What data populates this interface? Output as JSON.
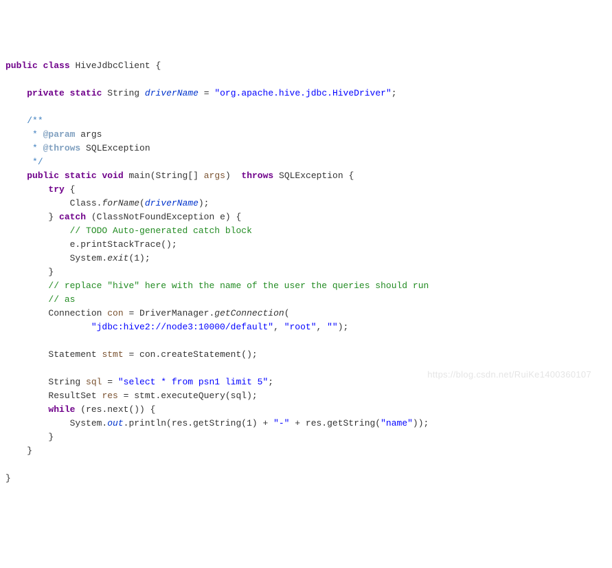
{
  "code": {
    "classDecl": {
      "kw1": "public",
      "kw2": "class",
      "name": "HiveJdbcClient",
      "lbrace": "{"
    },
    "field": {
      "kw1": "private",
      "kw2": "static",
      "type": "String",
      "name": "driverName",
      "eq": " = ",
      "value": "\"org.apache.hive.jdbc.HiveDriver\"",
      "semi": ";"
    },
    "jdoc_open": "/**",
    "jdoc_param_star": " * ",
    "jdoc_param_tag": "@param",
    "jdoc_param_name": " args",
    "jdoc_throws_star": " * ",
    "jdoc_throws_tag": "@throws",
    "jdoc_throws_name": " SQLException",
    "jdoc_close": " */",
    "main": {
      "kw1": "public",
      "kw2": "static",
      "kw3": "void",
      "name": "main",
      "lp": "(",
      "ptype": "String[]",
      "pname": " args",
      "rp": ")",
      "kw4": "throws",
      "ex": "SQLException",
      "lbrace": "{"
    },
    "try": "try",
    "try_lbrace": " {",
    "forName_class": "Class.",
    "forName_fn": "forName",
    "forName_lp": "(",
    "forName_arg": "driverName",
    "forName_rp": ");",
    "try_rbrace": "} ",
    "catch": "catch",
    "catch_parms": " (ClassNotFoundException e) {",
    "todo": "// TODO Auto-generated catch block",
    "pst": "e.printStackTrace();",
    "exit_pre": "System.",
    "exit_fn": "exit",
    "exit_post": "(1);",
    "catch_rbrace": "}",
    "cmt_run1": "// replace \"hive\" here with the name of the user the queries should run",
    "cmt_run2": "// as",
    "conn_decl": "Connection ",
    "conn_var": "con",
    "conn_eq": " = DriverManager.",
    "conn_fn": "getConnection",
    "conn_lp": "(",
    "conn_url": "\"jdbc:hive2://node3:10000/default\"",
    "conn_c1": ", ",
    "conn_user": "\"root\"",
    "conn_c2": ", ",
    "conn_pw": "\"\"",
    "conn_rp": ");",
    "stmt_decl": "Statement ",
    "stmt_var": "stmt",
    "stmt_rest": " = con.createStatement();",
    "sql_decl": "String ",
    "sql_var": "sql",
    "sql_eq": " = ",
    "sql_str": "\"select * from psn1 limit 5\"",
    "sql_semi": ";",
    "res_decl": "ResultSet ",
    "res_var": "res",
    "res_rest": " = stmt.executeQuery(sql);",
    "while_kw": "while",
    "while_cond": " (res.next()) {",
    "print_pre": "System.",
    "print_out": "out",
    "print_dot": ".println(res.getString(1) + ",
    "print_dash": "\"-\"",
    "print_mid": " + res.getString(",
    "print_name": "\"name\"",
    "print_end": "));",
    "while_rbrace": "}",
    "main_rbrace": "}",
    "class_rbrace": "}"
  },
  "watermark": "https://blog.csdn.net/RuiKe1400360107"
}
